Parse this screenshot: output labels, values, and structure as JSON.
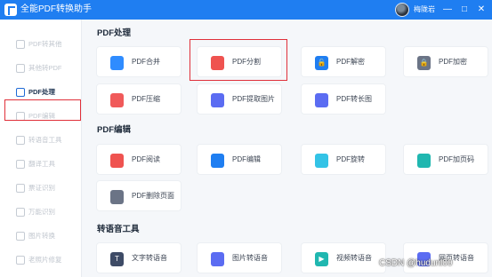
{
  "titlebar": {
    "app_title": "全能PDF转换助手",
    "username": "梅陇岩",
    "min_icon": "—",
    "max_icon": "□",
    "close_icon": "✕"
  },
  "sidebar": {
    "items": [
      {
        "label": "PDF转其他"
      },
      {
        "label": "其他转PDF"
      },
      {
        "label": "PDF处理"
      },
      {
        "label": "PDF编辑"
      },
      {
        "label": "转语音工具"
      },
      {
        "label": "翻译工具"
      },
      {
        "label": "票证识别"
      },
      {
        "label": "万能识别"
      },
      {
        "label": "图片转换"
      },
      {
        "label": "老照片修复"
      }
    ]
  },
  "sections": [
    {
      "title": "PDF处理"
    },
    {
      "title": "PDF编辑"
    },
    {
      "title": "转语音工具"
    }
  ],
  "cards": {
    "merge": {
      "label": "PDF合并",
      "color": "#2f8cff"
    },
    "split": {
      "label": "PDF分割",
      "color": "#ef5350"
    },
    "decrypt": {
      "label": "PDF解密",
      "color": "#1f7ef1"
    },
    "encrypt": {
      "label": "PDF加密",
      "color": "#6b7486"
    },
    "compress": {
      "label": "PDF压缩",
      "color": "#f05a5a"
    },
    "extract_images": {
      "label": "PDF提取图片",
      "color": "#5b6cf2"
    },
    "to_long_image": {
      "label": "PDF转长图",
      "color": "#5b6cf2"
    },
    "read": {
      "label": "PDF阅读",
      "color": "#ef5350"
    },
    "edit": {
      "label": "PDF编辑",
      "color": "#1f7ef1"
    },
    "rotate": {
      "label": "PDF旋转",
      "color": "#33c3e6"
    },
    "page_number": {
      "label": "PDF加页码",
      "color": "#20b7b0"
    },
    "delete_pages": {
      "label": "PDF删除页面",
      "color": "#6b7486"
    },
    "text_to_speech": {
      "label": "文字转语音",
      "color": "#3e4b66"
    },
    "image_to_speech": {
      "label": "图片转语音",
      "color": "#5b6cf2"
    },
    "video_to_speech": {
      "label": "视频转语音",
      "color": "#20b7b0"
    },
    "web_to_speech": {
      "label": "网页转语音",
      "color": "#5b6cf2"
    }
  },
  "watermark": "CSDN @huduni00"
}
